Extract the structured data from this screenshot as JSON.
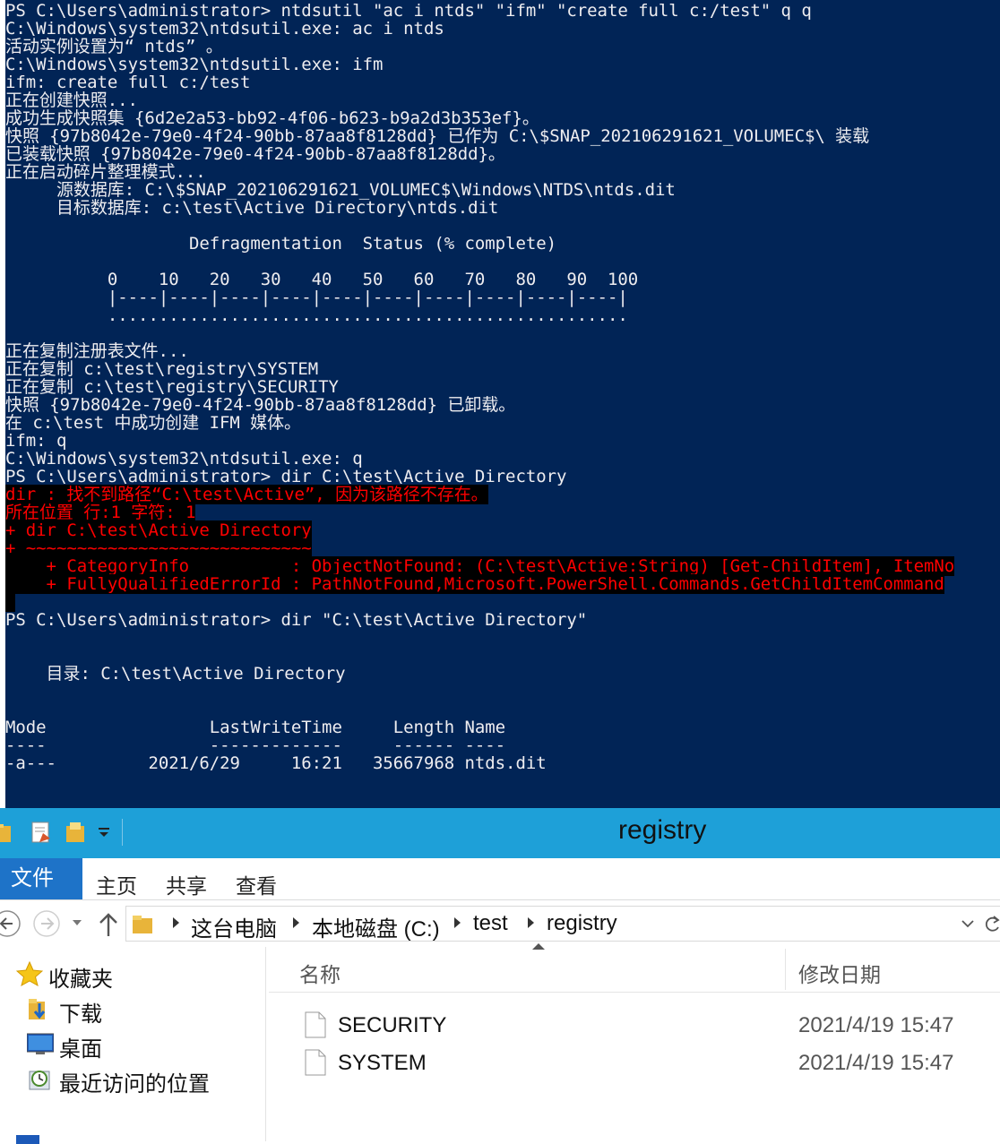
{
  "console": {
    "lines": [
      {
        "segs": [
          {
            "t": "PS C:\\Users\\administrator> ntdsutil \"ac i ntds\" \"ifm\" \"create full c:/test\" q q"
          }
        ]
      },
      {
        "segs": [
          {
            "t": "C:\\Windows\\system32\\ntdsutil.exe: ac i ntds"
          }
        ]
      },
      {
        "segs": [
          {
            "t": "活动实例设置为“ ntds” 。"
          }
        ]
      },
      {
        "segs": [
          {
            "t": "C:\\Windows\\system32\\ntdsutil.exe: ifm"
          }
        ]
      },
      {
        "segs": [
          {
            "t": "ifm: create full c:/test"
          }
        ]
      },
      {
        "segs": [
          {
            "t": "正在创建快照..."
          }
        ]
      },
      {
        "segs": [
          {
            "t": "成功生成快照集 {6d2e2a53-bb92-4f06-b623-b9a2d3b353ef}。"
          }
        ]
      },
      {
        "segs": [
          {
            "t": "快照 {97b8042e-79e0-4f24-90bb-87aa8f8128dd} 已作为 C:\\$SNAP_202106291621_VOLUMEC$\\ 装载"
          }
        ]
      },
      {
        "segs": [
          {
            "t": "已装载快照 {97b8042e-79e0-4f24-90bb-87aa8f8128dd}。"
          }
        ]
      },
      {
        "segs": [
          {
            "t": "正在启动碎片整理模式..."
          }
        ]
      },
      {
        "segs": [
          {
            "t": "     源数据库: C:\\$SNAP_202106291621_VOLUMEC$\\Windows\\NTDS\\ntds.dit"
          }
        ]
      },
      {
        "segs": [
          {
            "t": "     目标数据库: c:\\test\\Active Directory\\ntds.dit"
          }
        ]
      },
      {
        "segs": [
          {
            "t": ""
          }
        ]
      },
      {
        "segs": [
          {
            "t": "                  Defragmentation  Status (% complete)"
          }
        ]
      },
      {
        "segs": [
          {
            "t": ""
          }
        ]
      },
      {
        "segs": [
          {
            "t": "          0    10   20   30   40   50   60   70   80   90  100"
          }
        ]
      },
      {
        "segs": [
          {
            "t": "          |----|----|----|----|----|----|----|----|----|----|"
          }
        ]
      },
      {
        "segs": [
          {
            "t": "          ..................................................."
          }
        ]
      },
      {
        "segs": [
          {
            "t": ""
          }
        ]
      },
      {
        "segs": [
          {
            "t": "正在复制注册表文件..."
          }
        ]
      },
      {
        "segs": [
          {
            "t": "正在复制 c:\\test\\registry\\SYSTEM"
          }
        ]
      },
      {
        "segs": [
          {
            "t": "正在复制 c:\\test\\registry\\SECURITY"
          }
        ]
      },
      {
        "segs": [
          {
            "t": "快照 {97b8042e-79e0-4f24-90bb-87aa8f8128dd} 已卸载。"
          }
        ]
      },
      {
        "segs": [
          {
            "t": "在 c:\\test 中成功创建 IFM 媒体。"
          }
        ]
      },
      {
        "segs": [
          {
            "t": "ifm: q"
          }
        ]
      },
      {
        "segs": [
          {
            "t": "C:\\Windows\\system32\\ntdsutil.exe: q"
          }
        ]
      },
      {
        "segs": [
          {
            "t": "PS C:\\Users\\administrator> dir C:\\test\\Active Directory"
          }
        ]
      },
      {
        "segs": [
          {
            "t": "dir : 找不到路径“C:\\test\\Active”, 因为该路径不存在。",
            "err": true
          }
        ]
      },
      {
        "segs": [
          {
            "t": "所在位置 行:1 字符: 1",
            "err": true
          }
        ]
      },
      {
        "segs": [
          {
            "t": "+ dir C:\\test\\Active Directory",
            "err": true
          }
        ]
      },
      {
        "segs": [
          {
            "t": "+ ~~~~~~~~~~~~~~~~~~~~~~~~~~~~",
            "err": true
          }
        ]
      },
      {
        "segs": [
          {
            "t": "    + CategoryInfo          : ObjectNotFound: (C:\\test\\Active:String) [Get-ChildItem], ItemNo",
            "err": true
          }
        ]
      },
      {
        "segs": [
          {
            "t": "    + FullyQualifiedErrorId : PathNotFound,Microsoft.PowerShell.Commands.GetChildItemCommand",
            "err": true
          }
        ]
      },
      {
        "segs": [
          {
            "t": " ",
            "err": true
          }
        ]
      },
      {
        "segs": [
          {
            "t": "PS C:\\Users\\administrator> dir \"C:\\test\\Active Directory\""
          }
        ]
      },
      {
        "segs": [
          {
            "t": ""
          }
        ]
      },
      {
        "segs": [
          {
            "t": ""
          }
        ]
      },
      {
        "segs": [
          {
            "t": "    目录: C:\\test\\Active Directory"
          }
        ]
      },
      {
        "segs": [
          {
            "t": ""
          }
        ]
      },
      {
        "segs": [
          {
            "t": ""
          }
        ]
      },
      {
        "segs": [
          {
            "t": "Mode                LastWriteTime     Length Name"
          }
        ]
      },
      {
        "segs": [
          {
            "t": "----                -------------     ------ ----"
          }
        ]
      },
      {
        "segs": [
          {
            "t": "-a---         2021/6/29     16:21   35667968 ntds.dit"
          }
        ]
      }
    ]
  },
  "explorer": {
    "title": "registry",
    "ribbon_tabs": {
      "file": "文件",
      "home": "主页",
      "share": "共享",
      "view": "查看"
    },
    "breadcrumb": [
      "这台电脑",
      "本地磁盘 (C:)",
      "test",
      "registry"
    ],
    "nav_items": [
      {
        "label": "收藏夹",
        "icon": "star-icon"
      },
      {
        "label": "下载",
        "icon": "download-folder-icon"
      },
      {
        "label": "桌面",
        "icon": "desktop-icon"
      },
      {
        "label": "最近访问的位置",
        "icon": "recent-places-icon"
      }
    ],
    "columns": {
      "name": "名称",
      "modified": "修改日期"
    },
    "files": [
      {
        "name": "SECURITY",
        "modified": "2021/4/19 15:47"
      },
      {
        "name": "SYSTEM",
        "modified": "2021/4/19 15:47"
      }
    ],
    "colors": {
      "titlebar": "#1ea0d8",
      "file_tab": "#1e73c8",
      "console_bg": "#012456",
      "error": "#ff0000"
    }
  }
}
